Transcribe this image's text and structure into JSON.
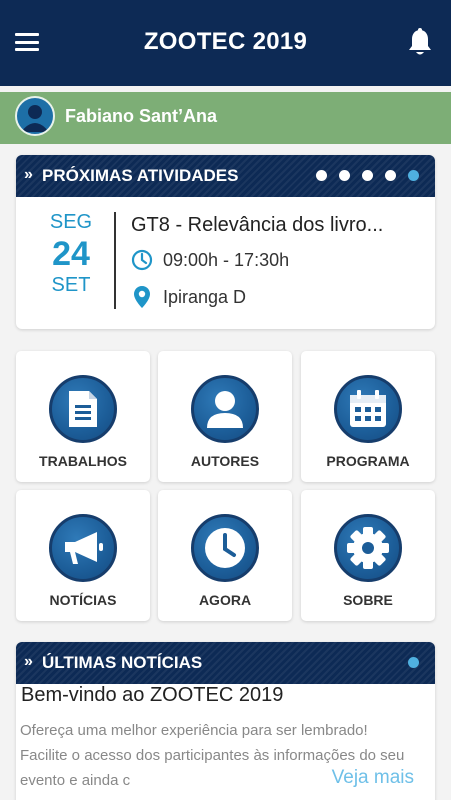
{
  "header": {
    "title": "ZOOTEC 2019",
    "menu_icon": "hamburger-icon",
    "notification_icon": "bell-icon"
  },
  "user": {
    "name": "Fabiano Sant’Ana",
    "avatar_icon": "user-avatar-icon"
  },
  "upcoming": {
    "title": "PRÓXIMAS ATIVIDADES",
    "event": {
      "weekday": "SEG",
      "day": "24",
      "month": "SET",
      "title": "GT8 - Relevância dos livro...",
      "time": "09:00h - 17:30h",
      "location": "Ipiranga D"
    },
    "pages": 5,
    "active_page": 5
  },
  "menu": [
    {
      "label": "TRABALHOS",
      "icon": "document-icon"
    },
    {
      "label": "AUTORES",
      "icon": "person-icon"
    },
    {
      "label": "PROGRAMA",
      "icon": "calendar-icon"
    },
    {
      "label": "NOTÍCIAS",
      "icon": "megaphone-icon"
    },
    {
      "label": "AGORA",
      "icon": "clock-icon"
    },
    {
      "label": "SOBRE",
      "icon": "gear-icon"
    }
  ],
  "news": {
    "title": "ÚLTIMAS NOTÍCIAS",
    "item": {
      "headline": "Bem-vindo ao ZOOTEC 2019",
      "body": "Ofereça uma melhor experiência para ser lembrado! Facilite o acesso dos participantes às informações do seu evento e ainda c",
      "more": "Veja mais"
    }
  },
  "colors": {
    "navy": "#0d2a55",
    "green": "#7dae76",
    "accent": "#1f95c8",
    "link": "#6fc0e8"
  }
}
